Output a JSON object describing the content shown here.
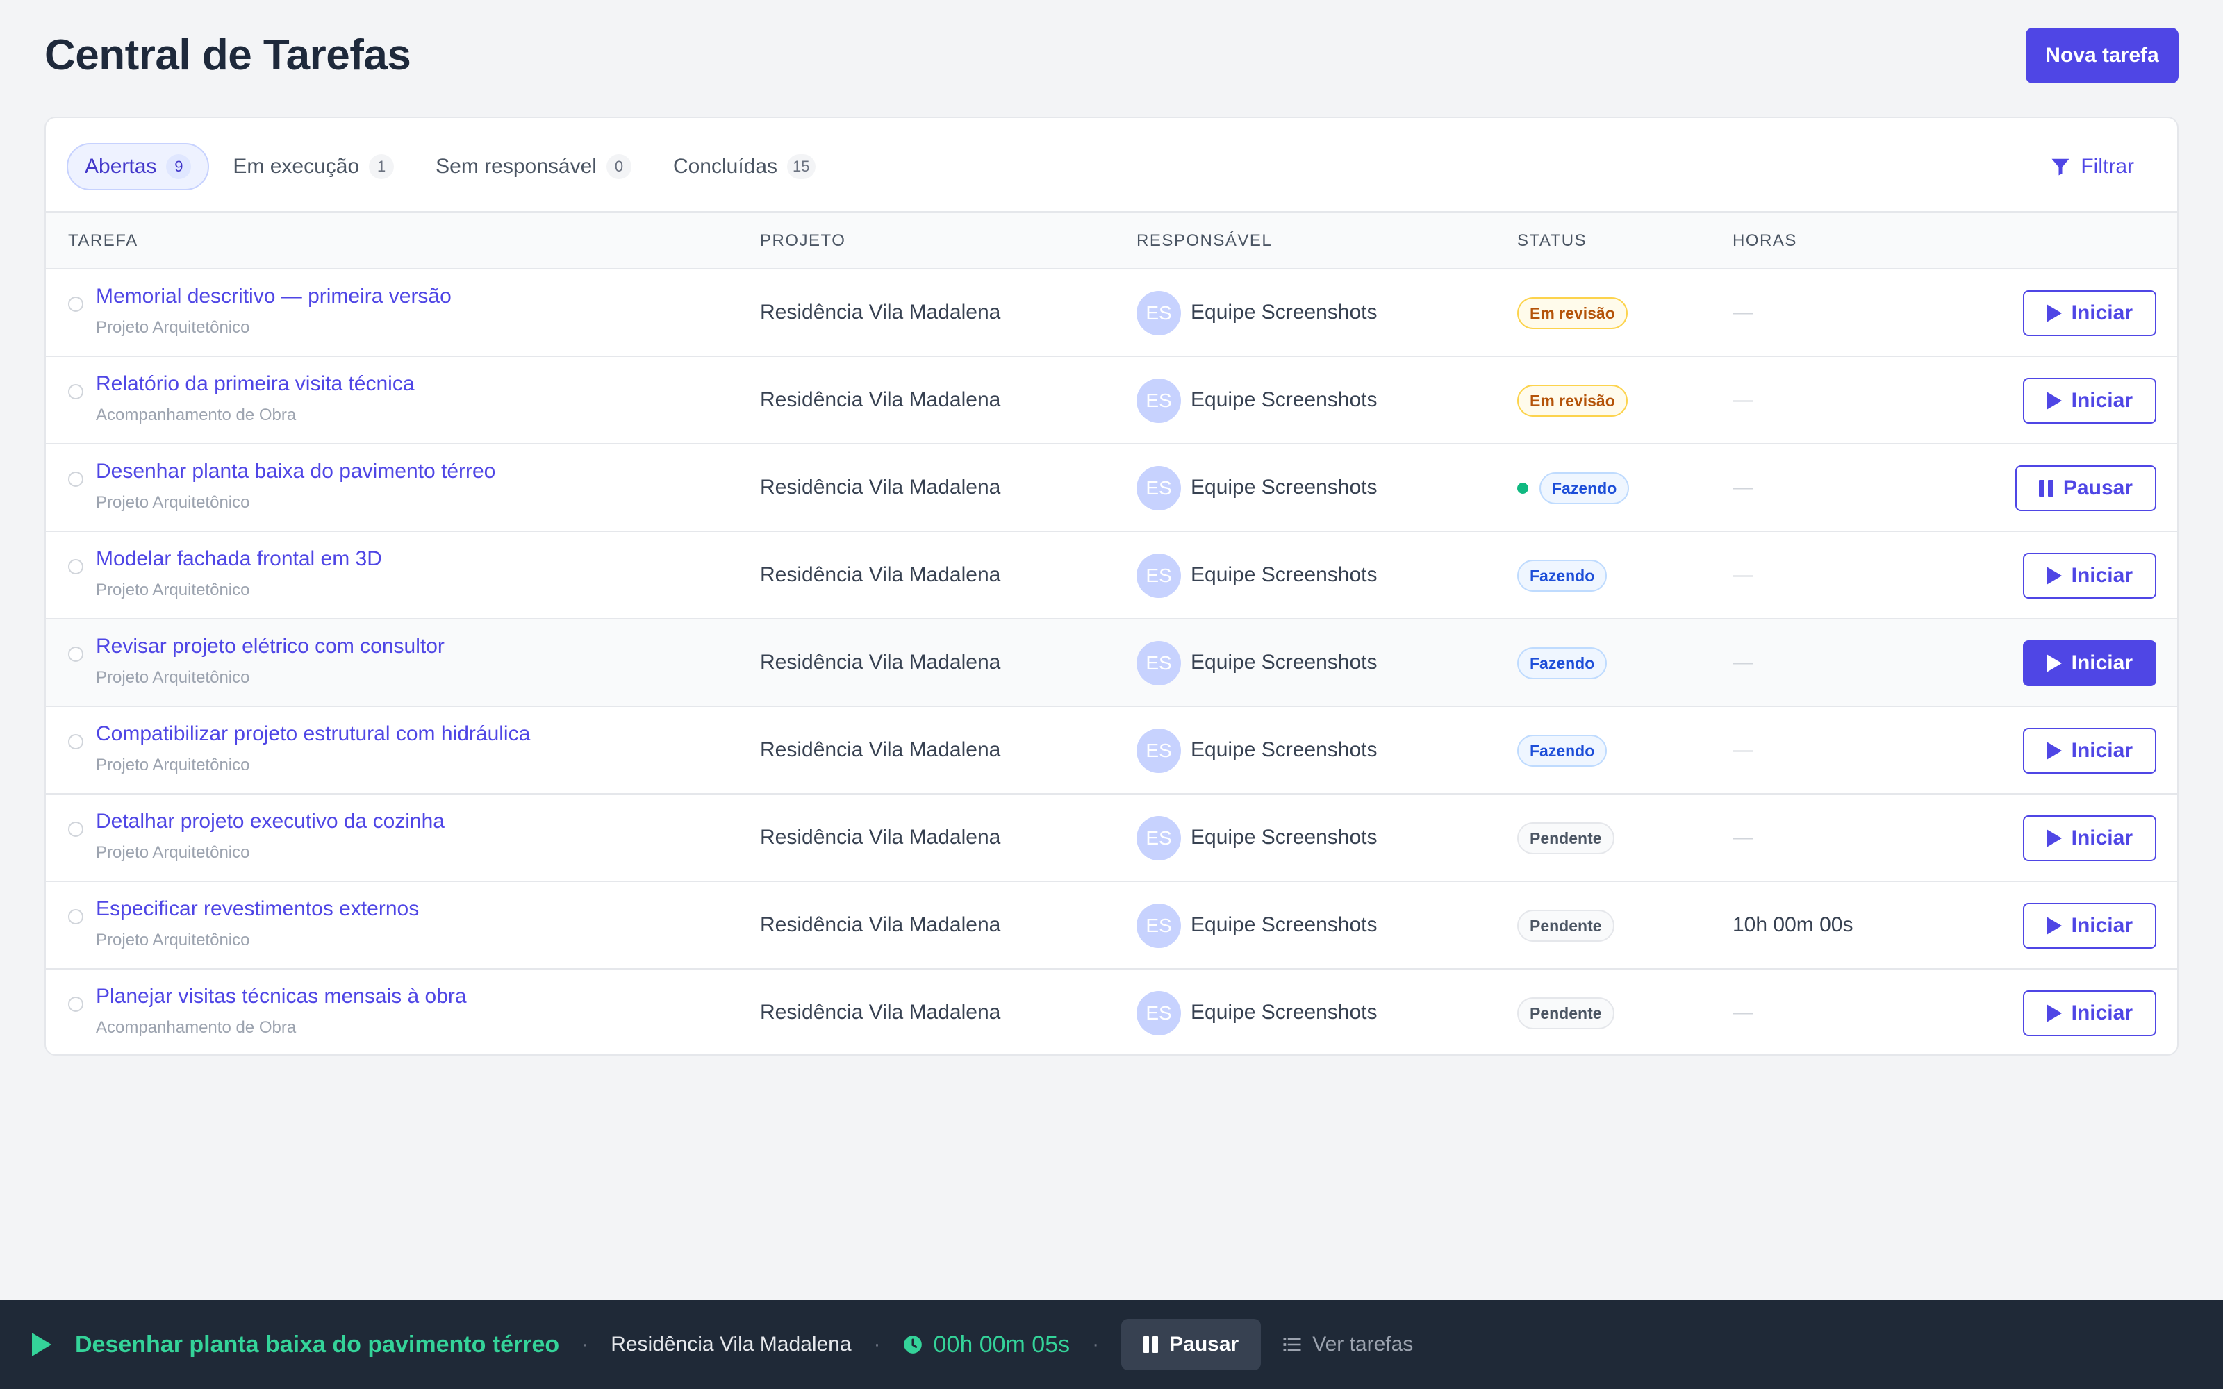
{
  "header": {
    "title": "Central de Tarefas",
    "new_task_label": "Nova tarefa"
  },
  "tabs": [
    {
      "label": "Abertas",
      "count": "9",
      "active": true
    },
    {
      "label": "Em execução",
      "count": "1",
      "active": false
    },
    {
      "label": "Sem responsável",
      "count": "0",
      "active": false
    },
    {
      "label": "Concluídas",
      "count": "15",
      "active": false
    }
  ],
  "filter_label": "Filtrar",
  "columns": {
    "task": "TAREFA",
    "project": "PROJETO",
    "responsible": "RESPONSÁVEL",
    "status": "STATUS",
    "hours": "HORAS"
  },
  "rows": [
    {
      "title": "Memorial descritivo — primeira versão",
      "subtitle": "Projeto Arquitetônico",
      "project": "Residência Vila Madalena",
      "avatar": "ES",
      "responsible": "Equipe Screenshots",
      "status": "Em revisão",
      "hours": "—",
      "action": "Iniciar"
    },
    {
      "title": "Relatório da primeira visita técnica",
      "subtitle": "Acompanhamento de Obra",
      "project": "Residência Vila Madalena",
      "avatar": "ES",
      "responsible": "Equipe Screenshots",
      "status": "Em revisão",
      "hours": "—",
      "action": "Iniciar"
    },
    {
      "title": "Desenhar planta baixa do pavimento térreo",
      "subtitle": "Projeto Arquitetônico",
      "project": "Residência Vila Madalena",
      "avatar": "ES",
      "responsible": "Equipe Screenshots",
      "status": "Fazendo",
      "hours": "—",
      "action": "Pausar"
    },
    {
      "title": "Modelar fachada frontal em 3D",
      "subtitle": "Projeto Arquitetônico",
      "project": "Residência Vila Madalena",
      "avatar": "ES",
      "responsible": "Equipe Screenshots",
      "status": "Fazendo",
      "hours": "—",
      "action": "Iniciar"
    },
    {
      "title": "Revisar projeto elétrico com consultor",
      "subtitle": "Projeto Arquitetônico",
      "project": "Residência Vila Madalena",
      "avatar": "ES",
      "responsible": "Equipe Screenshots",
      "status": "Fazendo",
      "hours": "—",
      "action": "Iniciar"
    },
    {
      "title": "Compatibilizar projeto estrutural com hidráulica",
      "subtitle": "Projeto Arquitetônico",
      "project": "Residência Vila Madalena",
      "avatar": "ES",
      "responsible": "Equipe Screenshots",
      "status": "Fazendo",
      "hours": "—",
      "action": "Iniciar"
    },
    {
      "title": "Detalhar projeto executivo da cozinha",
      "subtitle": "Projeto Arquitetônico",
      "project": "Residência Vila Madalena",
      "avatar": "ES",
      "responsible": "Equipe Screenshots",
      "status": "Pendente",
      "hours": "—",
      "action": "Iniciar"
    },
    {
      "title": "Especificar revestimentos externos",
      "subtitle": "Projeto Arquitetônico",
      "project": "Residência Vila Madalena",
      "avatar": "ES",
      "responsible": "Equipe Screenshots",
      "status": "Pendente",
      "hours": "10h 00m 00s",
      "action": "Iniciar"
    },
    {
      "title": "Planejar visitas técnicas mensais à obra",
      "subtitle": "Acompanhamento de Obra",
      "project": "Residência Vila Madalena",
      "avatar": "ES",
      "responsible": "Equipe Screenshots",
      "status": "Pendente",
      "hours": "—",
      "action": "Iniciar"
    }
  ],
  "timer_bar": {
    "task": "Desenhar planta baixa do pavimento térreo",
    "project": "Residência Vila Madalena",
    "elapsed": "00h 00m 05s",
    "pause_label": "Pausar",
    "view_tasks_label": "Ver tarefas"
  },
  "colors": {
    "accent": "#4f46e5",
    "timer_green": "#34d399",
    "bar_bg": "#1f2937"
  }
}
